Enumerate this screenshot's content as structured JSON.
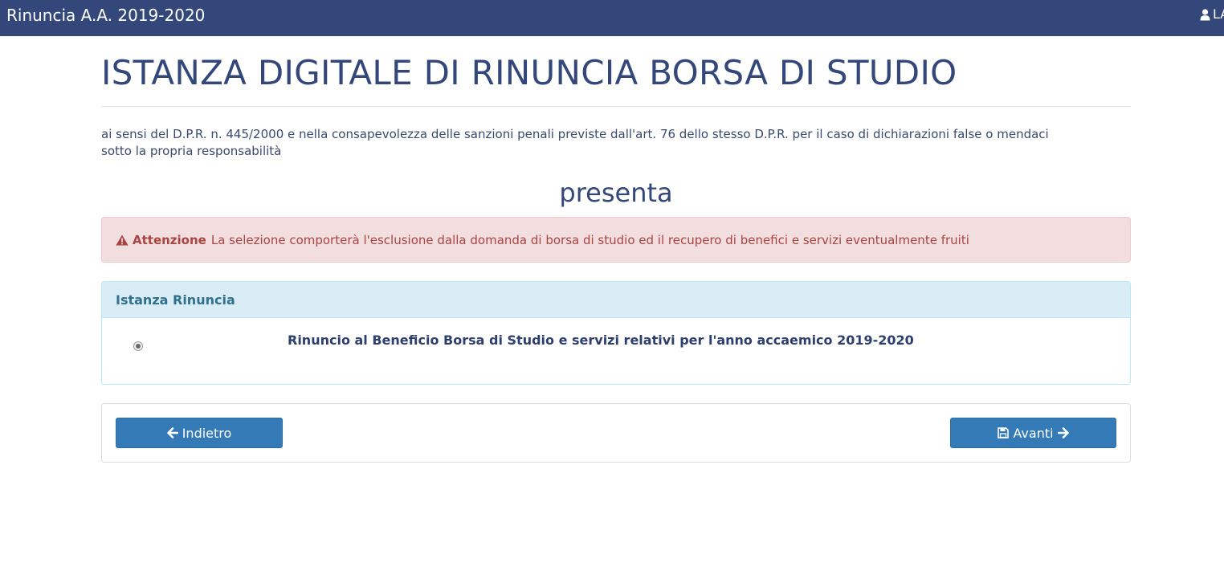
{
  "header": {
    "app_title": "Rinuncia A.A. 2019-2020",
    "user_label": "LA",
    "user_icon": "user-icon"
  },
  "main": {
    "title": "ISTANZA DIGITALE DI RINUNCIA BORSA DI STUDIO",
    "intro_line1": "ai sensi del D.P.R. n. 445/2000 e nella consapevolezza delle sanzioni penali previste dall'art. 76 dello stesso D.P.R. per il caso di dichiarazioni false o mendaci",
    "intro_line2": "sotto la propria responsabilità",
    "presenta": "presenta"
  },
  "alert": {
    "icon": "warning-icon",
    "strong": "Attenzione",
    "message": "La selezione comporterà l'esclusione dalla domanda di borsa di studio ed il recupero di benefici e servizi eventualmente fruiti"
  },
  "panel": {
    "heading": "Istanza Rinuncia",
    "option_label": "Rinuncio al Beneficio Borsa di Studio e servizi relativi per l'anno accaemico 2019-2020",
    "option_selected": true
  },
  "nav": {
    "back_label": "Indietro",
    "back_icon": "arrow-left-icon",
    "next_label": "Avanti",
    "next_icons": [
      "save-icon",
      "arrow-right-icon"
    ]
  },
  "colors": {
    "header_bg": "#34477a",
    "alert_bg": "#f2dede",
    "alert_text": "#a94442",
    "panel_heading_bg": "#d9edf7",
    "panel_heading_text": "#31708f",
    "button_bg": "#337ab7"
  }
}
